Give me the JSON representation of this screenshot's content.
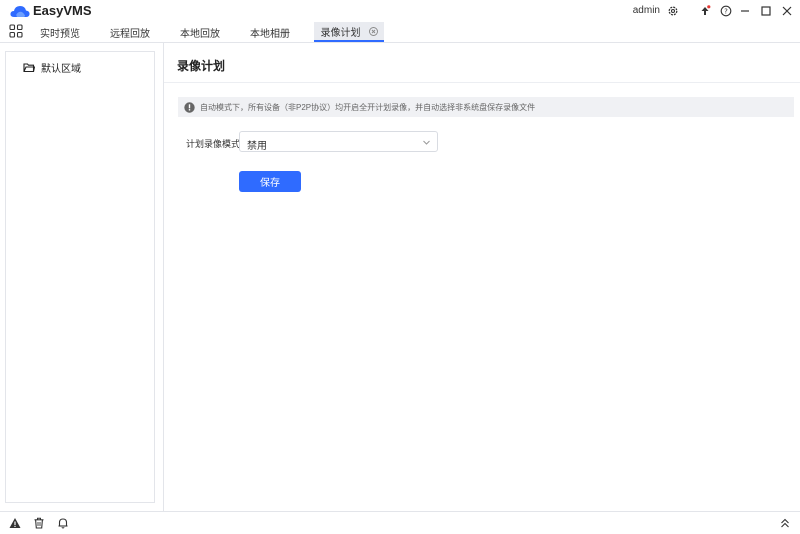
{
  "app": {
    "title": "EasyVMS"
  },
  "titlebar": {
    "user": "admin",
    "icons": [
      "settings-icon",
      "upload-icon",
      "help-icon",
      "minimize-icon",
      "maximize-icon",
      "close-icon"
    ]
  },
  "tabs": [
    {
      "label": "实时预览"
    },
    {
      "label": "远程回放"
    },
    {
      "label": "本地回放"
    },
    {
      "label": "本地相册"
    },
    {
      "label": "录像计划",
      "active": true
    }
  ],
  "sidebar": {
    "items": [
      {
        "label": "默认区域",
        "icon": "folder-icon"
      }
    ]
  },
  "main": {
    "title": "录像计划",
    "info": "自动模式下，所有设备（非P2P协议）均开启全开计划录像，并自动选择非系统盘保存录像文件",
    "form": {
      "mode_label": "计划录像模式",
      "mode_value": "禁用"
    },
    "save_label": "保存"
  },
  "statusbar": {
    "icons": [
      "warning-icon",
      "trash-icon",
      "bell-icon",
      "double-chevron-up-icon"
    ]
  },
  "colors": {
    "accent": "#2f6bff",
    "notify_dot": "#e53935"
  }
}
